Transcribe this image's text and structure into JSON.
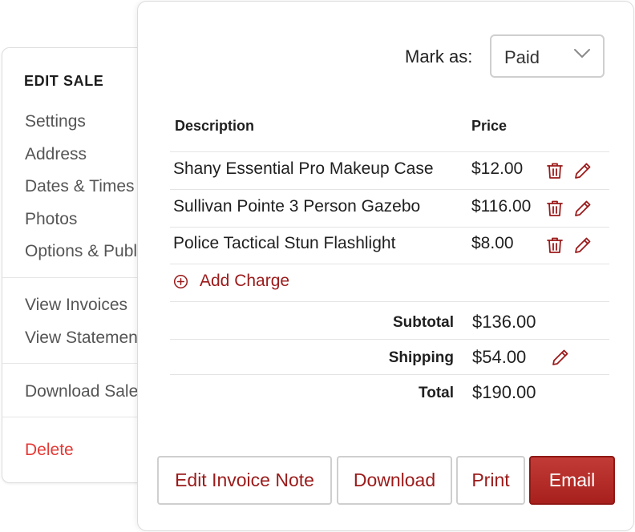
{
  "side_menu": {
    "title": "EDIT SALE",
    "group1": [
      "Settings",
      "Address",
      "Dates & Times",
      "Photos",
      "Options & Publish"
    ],
    "group2": [
      "View Invoices",
      "View Statements"
    ],
    "group3": [
      "Download Sale Data"
    ],
    "delete_label": "Delete"
  },
  "invoice": {
    "mark_as_label": "Mark as:",
    "status_value": "Paid",
    "columns": {
      "description": "Description",
      "price": "Price"
    },
    "items": [
      {
        "description": "Shany Essential Pro Makeup Case",
        "price": "$12.00"
      },
      {
        "description": "Sullivan Pointe 3 Person Gazebo",
        "price": "$116.00"
      },
      {
        "description": "Police Tactical Stun Flashlight",
        "price": "$8.00"
      }
    ],
    "add_charge_label": "Add Charge",
    "summary": {
      "subtotal_label": "Subtotal",
      "subtotal_value": "$136.00",
      "shipping_label": "Shipping",
      "shipping_value": "$54.00",
      "total_label": "Total",
      "total_value": "$190.00"
    },
    "buttons": {
      "edit_note": "Edit Invoice Note",
      "download": "Download",
      "print": "Print",
      "email": "Email"
    }
  },
  "colors": {
    "accent": "#9b1a1a",
    "primary_button": "#b22a26",
    "danger": "#e53935"
  },
  "icons": {
    "trash": "trash-icon",
    "edit": "pencil-icon",
    "add": "plus-circle-icon",
    "dropdown": "chevron-down-icon"
  }
}
